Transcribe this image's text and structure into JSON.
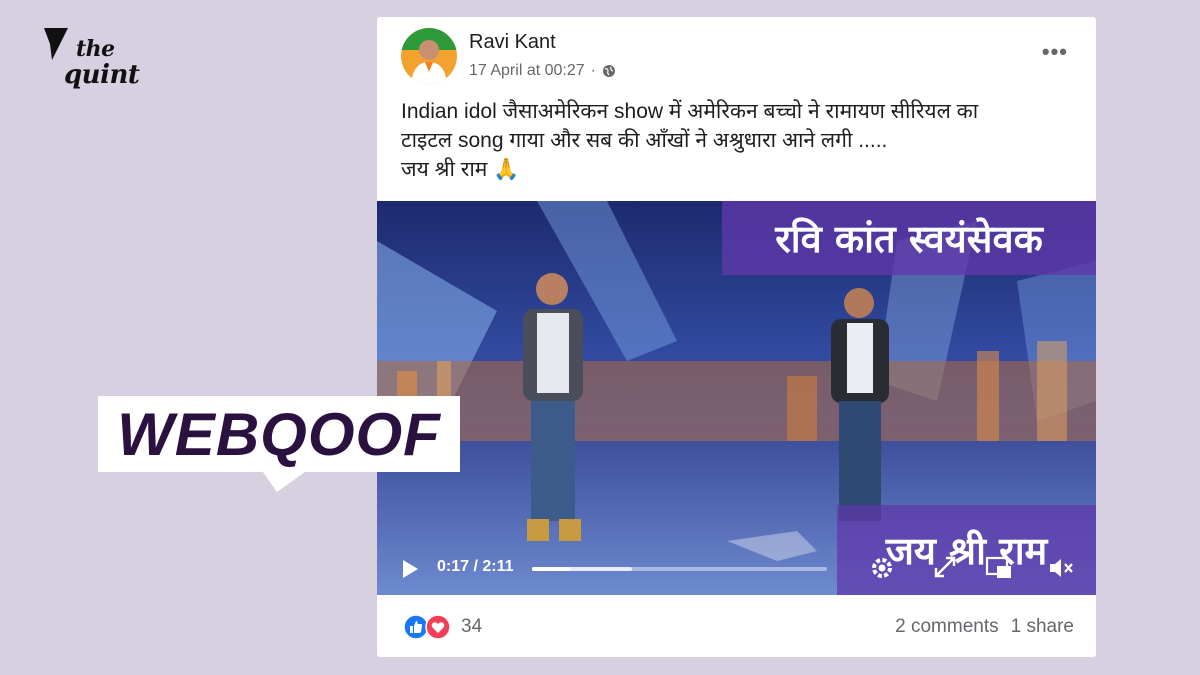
{
  "brand": {
    "line1": "the",
    "line2": "quint",
    "icon": "quint-quill-icon"
  },
  "post": {
    "author": "Ravi Kant",
    "date": "17 April at 00:27",
    "privacy_icon": "globe-icon",
    "more_label": "•••",
    "text_lines": [
      "Indian idol जैसाअमेरिकन show में अमेरिकन बच्चो ने रामायण सीरियल का",
      "टाइटल song गाया और सब की आँखों ने अश्रुधारा आने लगी .....",
      "जय श्री राम 🙏"
    ]
  },
  "video": {
    "overlay_top": "रवि कांत स्वयंसेवक",
    "overlay_bottom": "जय श्री राम",
    "current_time": "0:17",
    "duration": "2:11",
    "time_display": "0:17 / 2:11",
    "progress_fraction": 0.13,
    "buffered_fraction": 0.34,
    "icons": [
      "play-icon",
      "settings-gear-icon",
      "fullscreen-icon",
      "picture-in-picture-icon",
      "mute-icon"
    ]
  },
  "footer": {
    "reaction_icons": [
      "like-icon",
      "love-icon"
    ],
    "reaction_count": "34",
    "comments": "2 comments",
    "shares": "1 share",
    "like_color": "#1877f2",
    "love_color": "#f33e58"
  },
  "banner": {
    "text": "WEBQOOF",
    "text_color": "#2a1140"
  }
}
